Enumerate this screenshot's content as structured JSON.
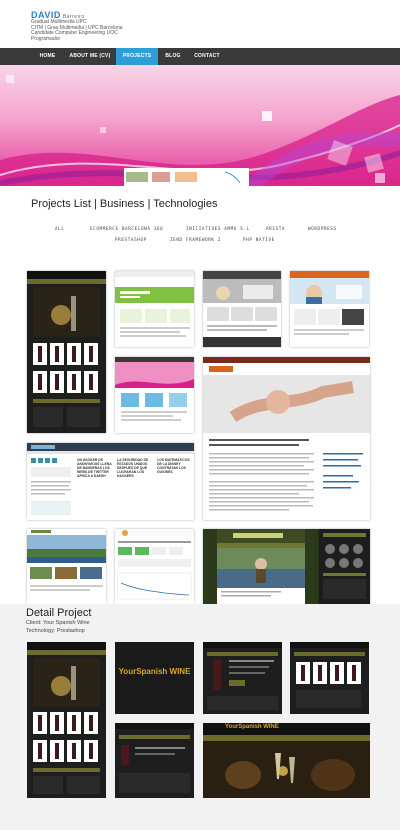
{
  "header": {
    "name": "DAVID",
    "surname": "Barreiro",
    "bio_lines": [
      "Graduat Multimedia UPC",
      "CITM | Grau Multimedia | UPC Barcelona",
      "Candidate Computer Engineering UOC",
      "Programador"
    ]
  },
  "nav": {
    "items": [
      "HOME",
      "ABOUT ME (CV)",
      "PROJECTS",
      "BLOG",
      "CONTACT"
    ],
    "active": "PROJECTS"
  },
  "projects": {
    "title": "Projects List | Business | Technologies",
    "filters_row1": [
      "ALL",
      "ECOMMERCE BARCELONA 360",
      "INICIATIVES AMMO S.L",
      "ARISTA",
      "WORDPRESS"
    ],
    "filters_row2": [
      "PRESTASHOP",
      "ZEND FRAMEWORK 2",
      "PHP NATIVE"
    ]
  },
  "thumb_texts": {
    "news1": "UN HACKER DE ANONYMOUS LLENA DE BANDERAS LOS WEBS DE TWITTER AFRICA A DAESH",
    "news2": "LA SEGURIDAD DE ESTADOS UNIDOS DESPUES DE QUE LUCHARAN LOS HACKERS",
    "news3": "LOS MATEMATICOS DE LA DISNEY CONTRATAN LOS GUIONES",
    "wine_logo": "YourSpanish WINE"
  },
  "detail": {
    "title": "Detail Project",
    "client_label": "Client:",
    "client": "Your Spanish Wine",
    "tech_label": "Technology:",
    "tech": "Prestashop"
  },
  "colors": {
    "accent": "#2e9fd6",
    "nav_bg": "#3a3a3a",
    "banner_pink": "#e33a98"
  }
}
